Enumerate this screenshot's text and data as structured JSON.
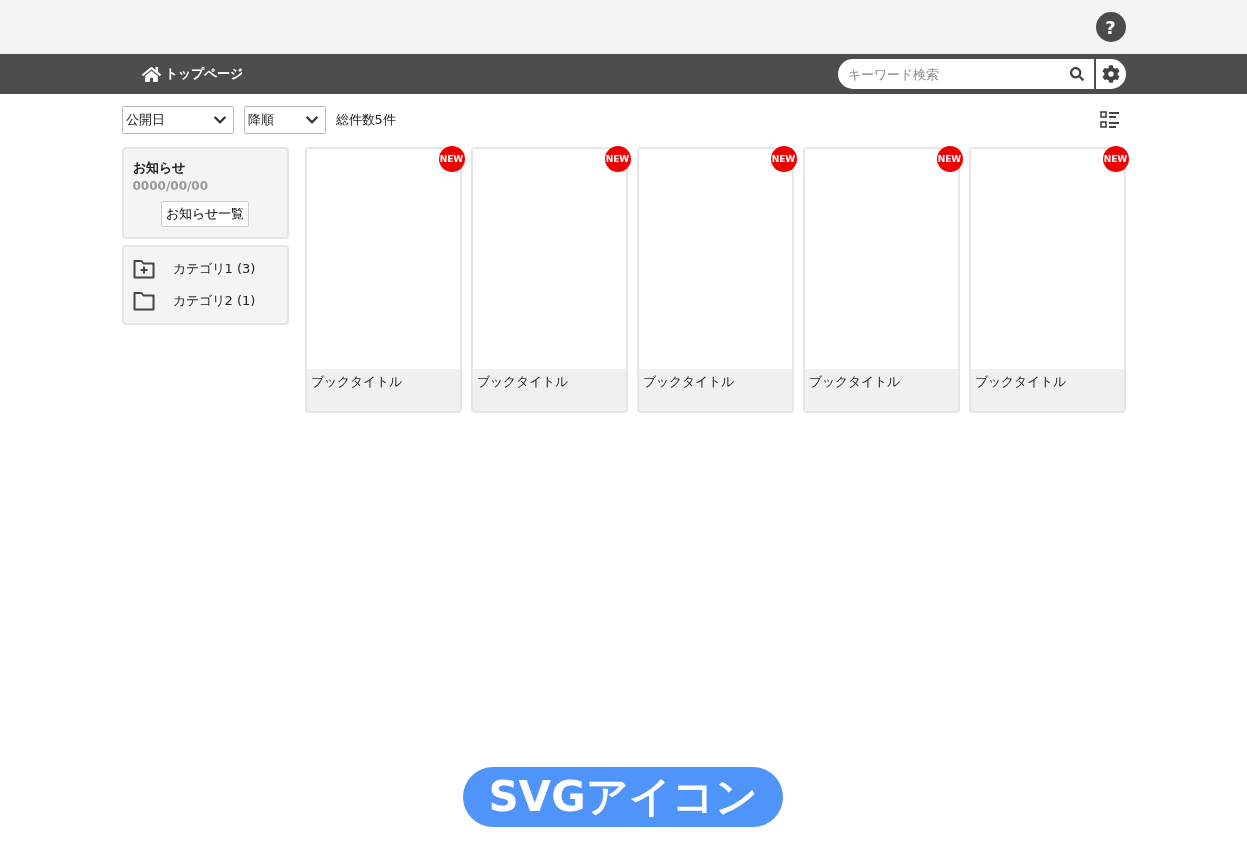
{
  "header": {
    "help_button": "?"
  },
  "nav": {
    "home_link": "トップページ",
    "search": {
      "placeholder": "キーワード検索"
    }
  },
  "toolbar": {
    "sort_field": "公開日",
    "sort_order": "降順",
    "total": "総件数5件"
  },
  "notice": {
    "title": "お知らせ",
    "date": "0000/00/00",
    "list_button": "お知らせ一覧"
  },
  "categories": [
    {
      "label": "カテゴリ1 (3)",
      "kind": "folder-plus"
    },
    {
      "label": "カテゴリ2 (1)",
      "kind": "folder"
    }
  ],
  "books": [
    {
      "title": "ブックタイトル",
      "badge": "NEW"
    },
    {
      "title": "ブックタイトル",
      "badge": "NEW"
    },
    {
      "title": "ブックタイトル",
      "badge": "NEW"
    },
    {
      "title": "ブックタイトル",
      "badge": "NEW"
    },
    {
      "title": "ブックタイトル",
      "badge": "NEW"
    }
  ],
  "caption": "SVGアイコン"
}
